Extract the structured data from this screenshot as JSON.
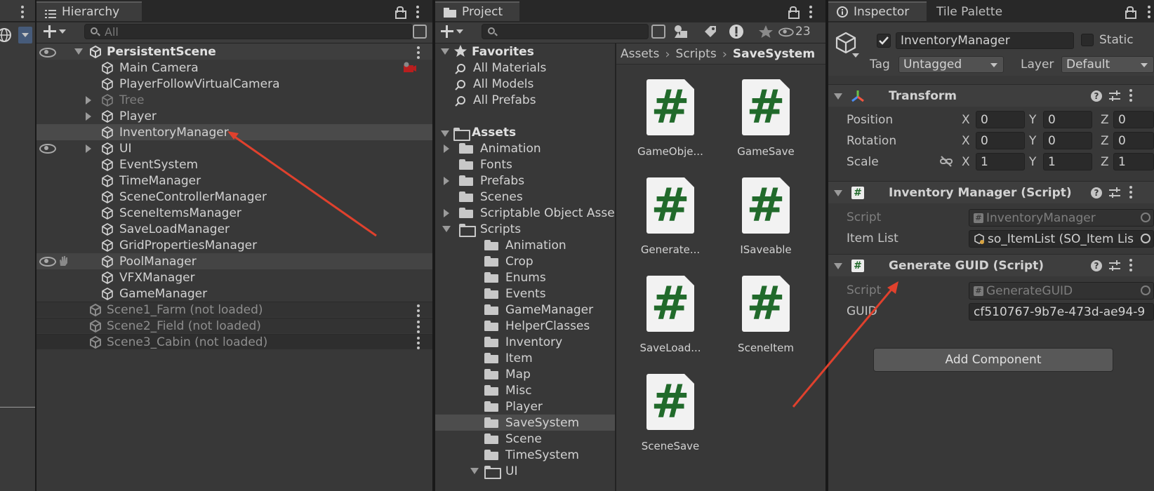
{
  "scene_view": {
    "globe_icon": "globe-icon"
  },
  "hierarchy": {
    "tab_label": "Hierarchy",
    "search_placeholder": "All",
    "root": {
      "label": "PersistentScene"
    },
    "items": [
      {
        "label": "Main Camera",
        "expandable": false,
        "dimmed": false
      },
      {
        "label": "PlayerFollowVirtualCamera",
        "expandable": false,
        "dimmed": false
      },
      {
        "label": "Tree",
        "expandable": true,
        "dimmed": true
      },
      {
        "label": "Player",
        "expandable": true,
        "dimmed": false
      },
      {
        "label": "InventoryManager",
        "expandable": false,
        "dimmed": false,
        "selected": true
      },
      {
        "label": "UI",
        "expandable": true,
        "dimmed": false
      },
      {
        "label": "EventSystem",
        "expandable": false,
        "dimmed": false
      },
      {
        "label": "TimeManager",
        "expandable": false,
        "dimmed": false
      },
      {
        "label": "SceneControllerManager",
        "expandable": false,
        "dimmed": false
      },
      {
        "label": "SceneItemsManager",
        "expandable": false,
        "dimmed": false
      },
      {
        "label": "SaveLoadManager",
        "expandable": false,
        "dimmed": false
      },
      {
        "label": "GridPropertiesManager",
        "expandable": false,
        "dimmed": false
      },
      {
        "label": "PoolManager",
        "expandable": false,
        "dimmed": false,
        "hover": true
      },
      {
        "label": "VFXManager",
        "expandable": false,
        "dimmed": false
      },
      {
        "label": "GameManager",
        "expandable": false,
        "dimmed": false
      }
    ],
    "unloaded_scenes": [
      {
        "label": "Scene1_Farm (not loaded)"
      },
      {
        "label": "Scene2_Field (not loaded)"
      },
      {
        "label": "Scene3_Cabin (not loaded)"
      }
    ]
  },
  "project": {
    "tab_label": "Project",
    "hidden_count": "23",
    "favorites": {
      "label": "Favorites",
      "items": [
        "All Materials",
        "All Models",
        "All Prefabs"
      ]
    },
    "assets": {
      "label": "Assets",
      "folders": [
        {
          "label": "Animation",
          "expandable": true
        },
        {
          "label": "Fonts",
          "expandable": false
        },
        {
          "label": "Prefabs",
          "expandable": true
        },
        {
          "label": "Scenes",
          "expandable": false
        },
        {
          "label": "Scriptable Object Assets",
          "expandable": true
        },
        {
          "label": "Scripts",
          "expandable": true,
          "open": true
        }
      ],
      "script_folders": [
        "Animation",
        "Crop",
        "Enums",
        "Events",
        "GameManager",
        "HelperClasses",
        "Inventory",
        "Item",
        "Map",
        "Misc",
        "Player",
        "SaveSystem",
        "Scene",
        "TimeSystem",
        "UI"
      ],
      "selected_folder": "SaveSystem"
    },
    "breadcrumb": [
      "Assets",
      "Scripts",
      "SaveSystem"
    ],
    "files": [
      "GameObje...",
      "GameSave",
      "Generate...",
      "ISaveable",
      "SaveLoad...",
      "SceneItem",
      "SceneSave"
    ]
  },
  "inspector": {
    "tab_label": "Inspector",
    "tab2_label": "Tile Palette",
    "object_name": "InventoryManager",
    "static_label": "Static",
    "tag_label": "Tag",
    "tag_value": "Untagged",
    "layer_label": "Layer",
    "layer_value": "Default",
    "transform": {
      "title": "Transform",
      "rows": [
        {
          "label": "Position",
          "x": "0",
          "y": "0",
          "z": "0"
        },
        {
          "label": "Rotation",
          "x": "0",
          "y": "0",
          "z": "0"
        },
        {
          "label": "Scale",
          "x": "1",
          "y": "1",
          "z": "1"
        }
      ],
      "axis_x": "X",
      "axis_y": "Y",
      "axis_z": "Z"
    },
    "components": [
      {
        "title": "Inventory Manager (Script)",
        "script_label": "Script",
        "script_value": "InventoryManager",
        "field_label": "Item List",
        "field_value": "so_ItemList (SO_Item Lis"
      },
      {
        "title": "Generate GUID (Script)",
        "script_label": "Script",
        "script_value": "GenerateGUID",
        "field_label": "GUID",
        "field_value": "cf510767-9b7e-473d-ae94-9"
      }
    ],
    "add_component_label": "Add Component"
  },
  "annotation_color": "#e0412d",
  "colors": {
    "folder": "#c8c8c8",
    "hash_green": "#216a2b",
    "selected_row": "#4d4d4d"
  }
}
